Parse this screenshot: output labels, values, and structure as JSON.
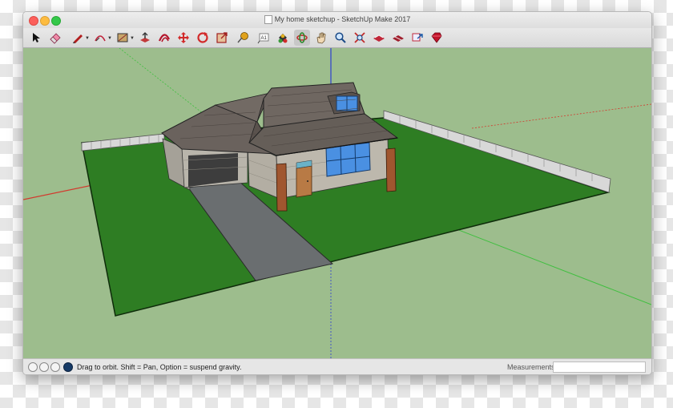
{
  "window": {
    "title": "My home sketchup - SketchUp Make 2017"
  },
  "toolbar": {
    "tools": [
      {
        "icon": "select-arrow-icon"
      },
      {
        "icon": "eraser-icon"
      },
      {
        "icon": "pencil-line-icon"
      },
      {
        "icon": "arc-icon"
      },
      {
        "icon": "rectangle-shape-icon"
      },
      {
        "icon": "push-pull-icon"
      },
      {
        "icon": "offset-icon"
      },
      {
        "icon": "move-icon"
      },
      {
        "icon": "rotate-icon"
      },
      {
        "icon": "scale-icon"
      },
      {
        "icon": "tape-measure-icon"
      },
      {
        "icon": "text-icon"
      },
      {
        "icon": "paint-bucket-icon"
      },
      {
        "icon": "orbit-icon"
      },
      {
        "icon": "pan-hand-icon"
      },
      {
        "icon": "zoom-icon"
      },
      {
        "icon": "zoom-extents-icon"
      },
      {
        "icon": "warehouse-icon"
      },
      {
        "icon": "extension-warehouse-icon"
      },
      {
        "icon": "share-model-icon"
      },
      {
        "icon": "ruby-icon"
      }
    ],
    "text_tool_label": "A1"
  },
  "statusbar": {
    "hint": "Drag to orbit. Shift = Pan, Option = suspend gravity.",
    "measurements_label": "Measurements",
    "measurements_value": ""
  },
  "colors": {
    "sky": "#9dbd8d",
    "lawn": "#2e7d23",
    "driveway": "#6a6e70",
    "roof": "#6a625d",
    "stone_wall": "#b9b5ab",
    "window_glass": "#4a90e2",
    "column": "#a0562f",
    "axis_red": "#d23a2e",
    "axis_green": "#3fbf3f",
    "axis_blue": "#2f3fd0"
  }
}
